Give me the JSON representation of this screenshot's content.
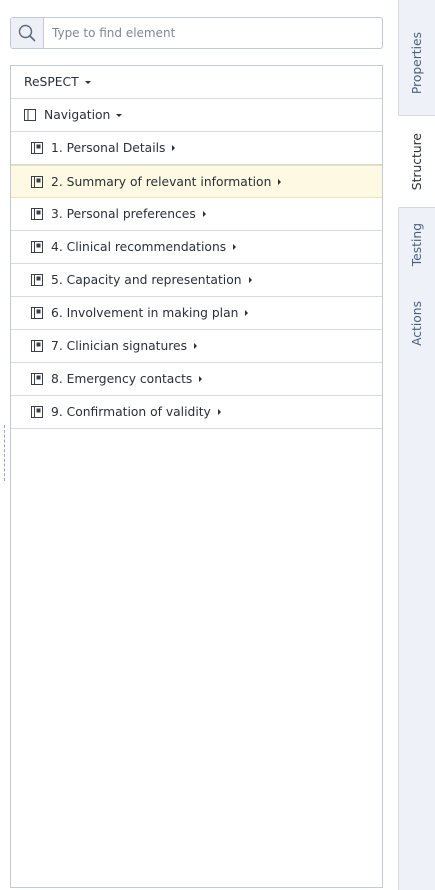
{
  "search": {
    "placeholder": "Type to find element"
  },
  "tree": {
    "root": {
      "label": "ReSPECT"
    },
    "navigation": {
      "label": "Navigation"
    },
    "items": [
      {
        "label": "1. Personal Details"
      },
      {
        "label": "2. Summary of relevant information",
        "selected": true
      },
      {
        "label": "3. Personal preferences"
      },
      {
        "label": "4. Clinical recommendations"
      },
      {
        "label": "5. Capacity and representation"
      },
      {
        "label": "6. Involvement in making plan"
      },
      {
        "label": "7. Clinician signatures"
      },
      {
        "label": "8. Emergency contacts"
      },
      {
        "label": "9. Confirmation of validity"
      }
    ]
  },
  "side_tabs": [
    {
      "label": "Properties"
    },
    {
      "label": "Structure",
      "active": true
    },
    {
      "label": "Testing"
    },
    {
      "label": "Actions"
    }
  ],
  "colors": {
    "selected_row": "#fdf9e2",
    "side_panel": "#eef1f8",
    "tab_text": "#4d5e7c"
  }
}
